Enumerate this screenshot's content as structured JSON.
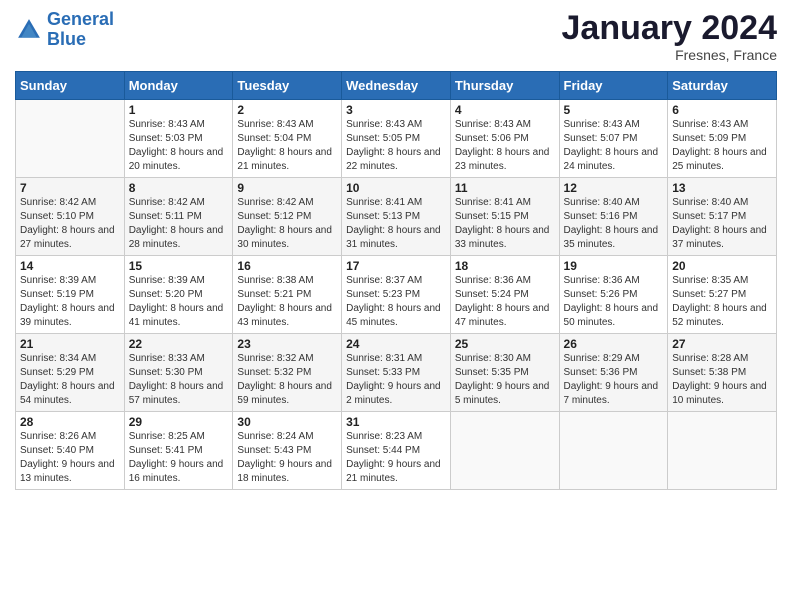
{
  "logo": {
    "line1": "General",
    "line2": "Blue"
  },
  "title": "January 2024",
  "location": "Fresnes, France",
  "days_header": [
    "Sunday",
    "Monday",
    "Tuesday",
    "Wednesday",
    "Thursday",
    "Friday",
    "Saturday"
  ],
  "weeks": [
    [
      {
        "num": "",
        "sunrise": "",
        "sunset": "",
        "daylight": ""
      },
      {
        "num": "1",
        "sunrise": "Sunrise: 8:43 AM",
        "sunset": "Sunset: 5:03 PM",
        "daylight": "Daylight: 8 hours and 20 minutes."
      },
      {
        "num": "2",
        "sunrise": "Sunrise: 8:43 AM",
        "sunset": "Sunset: 5:04 PM",
        "daylight": "Daylight: 8 hours and 21 minutes."
      },
      {
        "num": "3",
        "sunrise": "Sunrise: 8:43 AM",
        "sunset": "Sunset: 5:05 PM",
        "daylight": "Daylight: 8 hours and 22 minutes."
      },
      {
        "num": "4",
        "sunrise": "Sunrise: 8:43 AM",
        "sunset": "Sunset: 5:06 PM",
        "daylight": "Daylight: 8 hours and 23 minutes."
      },
      {
        "num": "5",
        "sunrise": "Sunrise: 8:43 AM",
        "sunset": "Sunset: 5:07 PM",
        "daylight": "Daylight: 8 hours and 24 minutes."
      },
      {
        "num": "6",
        "sunrise": "Sunrise: 8:43 AM",
        "sunset": "Sunset: 5:09 PM",
        "daylight": "Daylight: 8 hours and 25 minutes."
      }
    ],
    [
      {
        "num": "7",
        "sunrise": "Sunrise: 8:42 AM",
        "sunset": "Sunset: 5:10 PM",
        "daylight": "Daylight: 8 hours and 27 minutes."
      },
      {
        "num": "8",
        "sunrise": "Sunrise: 8:42 AM",
        "sunset": "Sunset: 5:11 PM",
        "daylight": "Daylight: 8 hours and 28 minutes."
      },
      {
        "num": "9",
        "sunrise": "Sunrise: 8:42 AM",
        "sunset": "Sunset: 5:12 PM",
        "daylight": "Daylight: 8 hours and 30 minutes."
      },
      {
        "num": "10",
        "sunrise": "Sunrise: 8:41 AM",
        "sunset": "Sunset: 5:13 PM",
        "daylight": "Daylight: 8 hours and 31 minutes."
      },
      {
        "num": "11",
        "sunrise": "Sunrise: 8:41 AM",
        "sunset": "Sunset: 5:15 PM",
        "daylight": "Daylight: 8 hours and 33 minutes."
      },
      {
        "num": "12",
        "sunrise": "Sunrise: 8:40 AM",
        "sunset": "Sunset: 5:16 PM",
        "daylight": "Daylight: 8 hours and 35 minutes."
      },
      {
        "num": "13",
        "sunrise": "Sunrise: 8:40 AM",
        "sunset": "Sunset: 5:17 PM",
        "daylight": "Daylight: 8 hours and 37 minutes."
      }
    ],
    [
      {
        "num": "14",
        "sunrise": "Sunrise: 8:39 AM",
        "sunset": "Sunset: 5:19 PM",
        "daylight": "Daylight: 8 hours and 39 minutes."
      },
      {
        "num": "15",
        "sunrise": "Sunrise: 8:39 AM",
        "sunset": "Sunset: 5:20 PM",
        "daylight": "Daylight: 8 hours and 41 minutes."
      },
      {
        "num": "16",
        "sunrise": "Sunrise: 8:38 AM",
        "sunset": "Sunset: 5:21 PM",
        "daylight": "Daylight: 8 hours and 43 minutes."
      },
      {
        "num": "17",
        "sunrise": "Sunrise: 8:37 AM",
        "sunset": "Sunset: 5:23 PM",
        "daylight": "Daylight: 8 hours and 45 minutes."
      },
      {
        "num": "18",
        "sunrise": "Sunrise: 8:36 AM",
        "sunset": "Sunset: 5:24 PM",
        "daylight": "Daylight: 8 hours and 47 minutes."
      },
      {
        "num": "19",
        "sunrise": "Sunrise: 8:36 AM",
        "sunset": "Sunset: 5:26 PM",
        "daylight": "Daylight: 8 hours and 50 minutes."
      },
      {
        "num": "20",
        "sunrise": "Sunrise: 8:35 AM",
        "sunset": "Sunset: 5:27 PM",
        "daylight": "Daylight: 8 hours and 52 minutes."
      }
    ],
    [
      {
        "num": "21",
        "sunrise": "Sunrise: 8:34 AM",
        "sunset": "Sunset: 5:29 PM",
        "daylight": "Daylight: 8 hours and 54 minutes."
      },
      {
        "num": "22",
        "sunrise": "Sunrise: 8:33 AM",
        "sunset": "Sunset: 5:30 PM",
        "daylight": "Daylight: 8 hours and 57 minutes."
      },
      {
        "num": "23",
        "sunrise": "Sunrise: 8:32 AM",
        "sunset": "Sunset: 5:32 PM",
        "daylight": "Daylight: 8 hours and 59 minutes."
      },
      {
        "num": "24",
        "sunrise": "Sunrise: 8:31 AM",
        "sunset": "Sunset: 5:33 PM",
        "daylight": "Daylight: 9 hours and 2 minutes."
      },
      {
        "num": "25",
        "sunrise": "Sunrise: 8:30 AM",
        "sunset": "Sunset: 5:35 PM",
        "daylight": "Daylight: 9 hours and 5 minutes."
      },
      {
        "num": "26",
        "sunrise": "Sunrise: 8:29 AM",
        "sunset": "Sunset: 5:36 PM",
        "daylight": "Daylight: 9 hours and 7 minutes."
      },
      {
        "num": "27",
        "sunrise": "Sunrise: 8:28 AM",
        "sunset": "Sunset: 5:38 PM",
        "daylight": "Daylight: 9 hours and 10 minutes."
      }
    ],
    [
      {
        "num": "28",
        "sunrise": "Sunrise: 8:26 AM",
        "sunset": "Sunset: 5:40 PM",
        "daylight": "Daylight: 9 hours and 13 minutes."
      },
      {
        "num": "29",
        "sunrise": "Sunrise: 8:25 AM",
        "sunset": "Sunset: 5:41 PM",
        "daylight": "Daylight: 9 hours and 16 minutes."
      },
      {
        "num": "30",
        "sunrise": "Sunrise: 8:24 AM",
        "sunset": "Sunset: 5:43 PM",
        "daylight": "Daylight: 9 hours and 18 minutes."
      },
      {
        "num": "31",
        "sunrise": "Sunrise: 8:23 AM",
        "sunset": "Sunset: 5:44 PM",
        "daylight": "Daylight: 9 hours and 21 minutes."
      },
      {
        "num": "",
        "sunrise": "",
        "sunset": "",
        "daylight": ""
      },
      {
        "num": "",
        "sunrise": "",
        "sunset": "",
        "daylight": ""
      },
      {
        "num": "",
        "sunrise": "",
        "sunset": "",
        "daylight": ""
      }
    ]
  ]
}
